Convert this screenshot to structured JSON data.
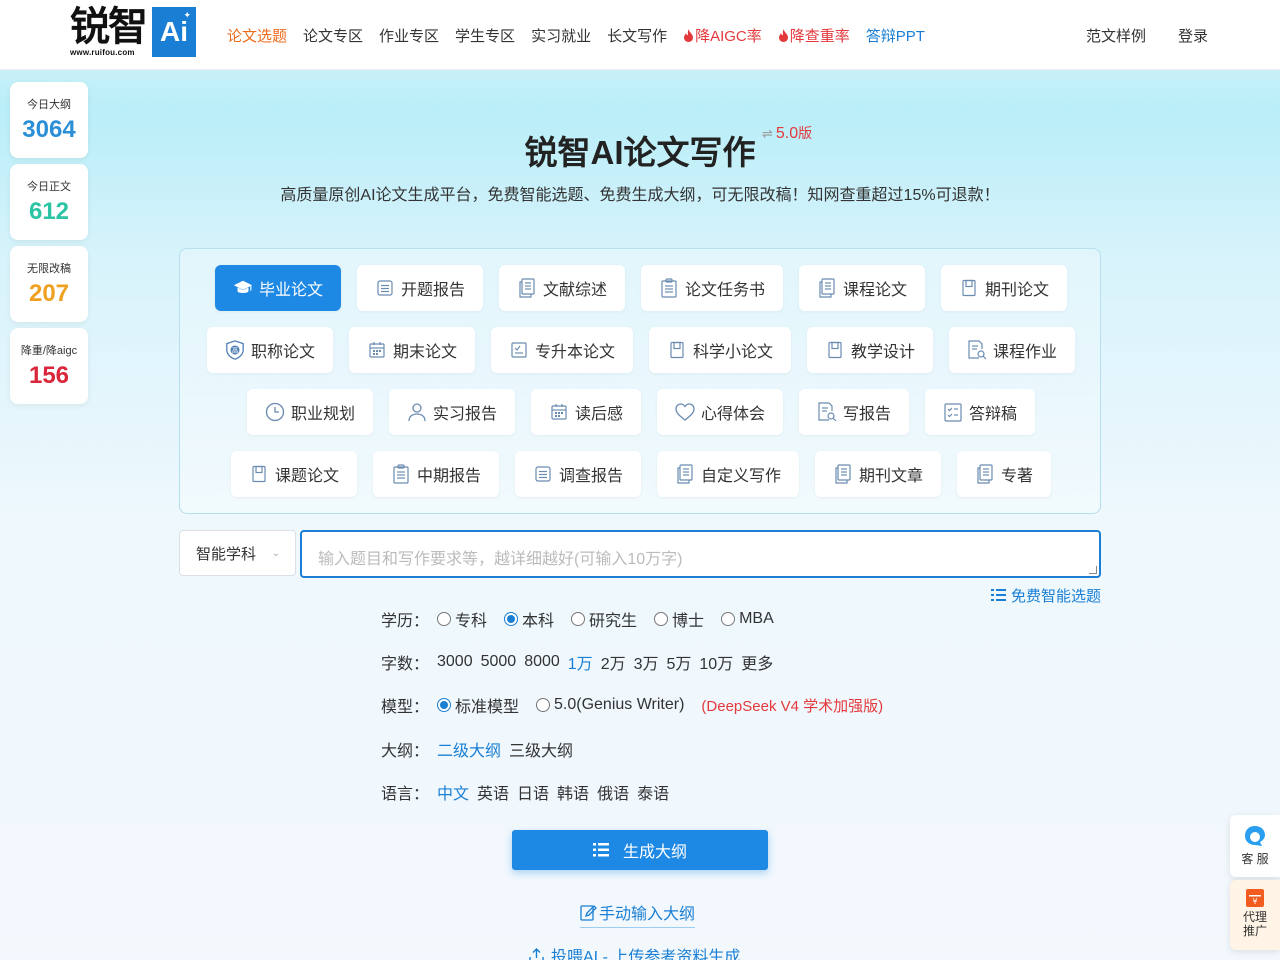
{
  "header": {
    "logo_cn": "锐智",
    "logo_ai": "Ai",
    "logo_url": "www.ruifou.com",
    "nav": [
      {
        "label": "论文选题",
        "style": "active"
      },
      {
        "label": "论文专区",
        "style": ""
      },
      {
        "label": "作业专区",
        "style": ""
      },
      {
        "label": "学生专区",
        "style": ""
      },
      {
        "label": "实习就业",
        "style": ""
      },
      {
        "label": "长文写作",
        "style": ""
      },
      {
        "label": "降AIGC率",
        "style": "hot"
      },
      {
        "label": "降查重率",
        "style": "hot"
      },
      {
        "label": "答辩PPT",
        "style": "ppt"
      }
    ],
    "samples": "范文样例",
    "login": "登录"
  },
  "stats": [
    {
      "label": "今日大纲",
      "value": "3064",
      "color": "#2a8fd6"
    },
    {
      "label": "今日正文",
      "value": "612",
      "color": "#2bc4a4"
    },
    {
      "label": "无限改稿",
      "value": "207",
      "color": "#f0a020"
    },
    {
      "label": "降重/降aigc",
      "value": "156",
      "color": "#d9263b"
    }
  ],
  "hero": {
    "title": "锐智AI论文写作",
    "version_swap": "⇌",
    "version": "5.0",
    "version_suffix": "版",
    "subtitle": "高质量原创AI论文生成平台，免费智能选题、免费生成大纲，可无限改稿！知网查重超过15%可退款！"
  },
  "types": [
    [
      "毕业论文",
      "开题报告",
      "文献综述",
      "论文任务书",
      "课程论文",
      "期刊论文"
    ],
    [
      "职称论文",
      "期末论文",
      "专升本论文",
      "科学小论文",
      "教学设计",
      "课程作业"
    ],
    [
      "职业规划",
      "实习报告",
      "读后感",
      "心得体会",
      "写报告",
      "答辩稿"
    ],
    [
      "课题论文",
      "中期报告",
      "调查报告",
      "自定义写作",
      "期刊文章",
      "专著"
    ]
  ],
  "form": {
    "subject": "智能学科",
    "topic_placeholder": "输入题目和写作要求等，越详细越好(可输入10万字)",
    "free_topic": "免费智能选题",
    "education": {
      "label": "学历：",
      "options": [
        "专科",
        "本科",
        "研究生",
        "博士",
        "MBA"
      ],
      "selected": "本科"
    },
    "wordcount": {
      "label": "字数：",
      "options": [
        "3000",
        "5000",
        "8000",
        "1万",
        "2万",
        "3万",
        "5万",
        "10万",
        "更多"
      ],
      "selected": "1万"
    },
    "model": {
      "label": "模型：",
      "options": [
        "标准模型",
        "5.0(Genius Writer)"
      ],
      "selected": "标准模型",
      "note": "(DeepSeek V4 学术加强版)"
    },
    "outline": {
      "label": "大纲：",
      "options": [
        "二级大纲",
        "三级大纲"
      ],
      "selected": "二级大纲"
    },
    "language": {
      "label": "语言：",
      "options": [
        "中文",
        "英语",
        "日语",
        "韩语",
        "俄语",
        "泰语"
      ],
      "selected": "中文"
    }
  },
  "actions": {
    "generate": "生成大纲",
    "manual": "手动输入大纲",
    "upload": "投喂AI - 上传参考资料生成"
  },
  "float": {
    "service": "客 服",
    "agent_line1": "代理",
    "agent_line2": "推广"
  },
  "colors": {
    "accent": "#1e88e5",
    "nav_active": "#ee6a1b",
    "hot": "#e4393c"
  }
}
